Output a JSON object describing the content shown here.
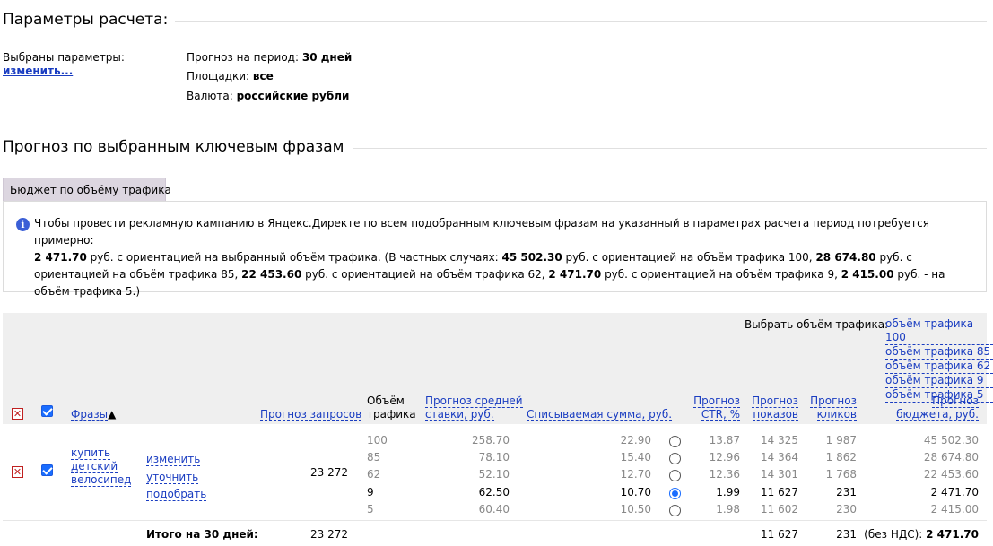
{
  "params": {
    "title": "Параметры расчета:",
    "selected_label": "Выбраны параметры:",
    "change_link": "изменить...",
    "period_label": "Прогноз на период:",
    "period_value": "30 дней",
    "platforms_label": "Площадки:",
    "platforms_value": "все",
    "currency_label": "Валюта:",
    "currency_value": "российские рубли"
  },
  "forecast": {
    "title": "Прогноз по выбранным ключевым фразам",
    "tab": "Бюджет по объёму трафика",
    "info": {
      "t1": "Чтобы провести рекламную кампанию в Яндекс.Директе по всем подобранным ключевым фразам на указанный в параметрах расчета период потребуется примерно:",
      "b1": "2 471.70",
      "t2": " руб. с ориентацией на выбранный объём трафика. (В частных случаях: ",
      "b2": "45 502.30",
      "t3": " руб. с ориентацией на объём трафика 100, ",
      "b3": "28 674.80",
      "t4": " руб. с ориентацией на объём трафика 85, ",
      "b4": "22 453.60",
      "t5": " руб. с ориентацией на объём трафика 62, ",
      "b5": "2 471.70",
      "t6": " руб. с ориентацией на объём трафика 9, ",
      "b6": "2 415.00",
      "t7": " руб. - на объём трафика 5.)"
    }
  },
  "table": {
    "select_traffic_label": "Выбрать объём трафика:",
    "traffic_links": [
      "объём трафика 100",
      "объём трафика 85",
      "объём трафика 62",
      "объём трафика 9",
      "объём трафика 5"
    ],
    "headers": {
      "phrases": "Фразы",
      "sort_arrow": "▲",
      "queries": "Прогноз запросов",
      "traffic_1": "Объём",
      "traffic_2": "трафика",
      "avg_bid_1": "Прогноз средней",
      "avg_bid_2": "ставки, руб.",
      "charge": "Списываемая сумма, руб.",
      "ctr_1": "Прогноз",
      "ctr_2": "CTR, %",
      "shows_1": "Прогноз",
      "shows_2": "показов",
      "clicks_1": "Прогноз",
      "clicks_2": "кликов",
      "budget_1": "Прогноз",
      "budget_2": "бюджета, руб."
    },
    "row": {
      "phrase_1": "купить",
      "phrase_2": "детский",
      "phrase_3": "велосипед",
      "action_change": "изменить",
      "action_refine": "уточнить",
      "action_pick": "подобрать",
      "queries": "23 272",
      "options": [
        {
          "traffic": "100",
          "bid": "258.70",
          "charge": "22.90",
          "ctr": "13.87",
          "shows": "14 325",
          "clicks": "1 987",
          "budget": "45 502.30",
          "selected": false
        },
        {
          "traffic": "85",
          "bid": "78.10",
          "charge": "15.40",
          "ctr": "12.96",
          "shows": "14 364",
          "clicks": "1 862",
          "budget": "28 674.80",
          "selected": false
        },
        {
          "traffic": "62",
          "bid": "52.10",
          "charge": "12.70",
          "ctr": "12.36",
          "shows": "14 301",
          "clicks": "1 768",
          "budget": "22 453.60",
          "selected": false
        },
        {
          "traffic": "9",
          "bid": "62.50",
          "charge": "10.70",
          "ctr": "1.99",
          "shows": "11 627",
          "clicks": "231",
          "budget": "2 471.70",
          "selected": true
        },
        {
          "traffic": "5",
          "bid": "60.40",
          "charge": "10.50",
          "ctr": "1.98",
          "shows": "11 602",
          "clicks": "230",
          "budget": "2 415.00",
          "selected": false
        }
      ]
    },
    "total": {
      "label": "Итого на 30 дней:",
      "queries": "23 272",
      "shows": "11 627",
      "clicks": "231",
      "vat_label": "(без НДС):",
      "budget": "2 471.70"
    }
  },
  "colors": {
    "link": "#1a3dc1",
    "checkbox": "#1a6dff",
    "delete": "#c02020",
    "tab_bg": "#dcd6e0",
    "header_bg": "#efefef"
  }
}
